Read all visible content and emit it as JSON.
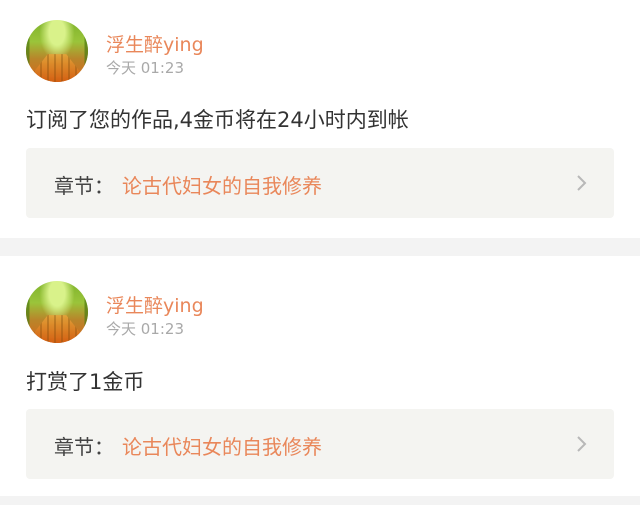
{
  "notifications": [
    {
      "username": "浮生醉ying",
      "time": "今天 01:23",
      "message": "订阅了您的作品,4金币将在24小时内到帐",
      "chapter_prefix": "章节：",
      "chapter_title": "论古代妇女的自我修养",
      "chevron_icon": "chevron-right-icon"
    },
    {
      "username": "浮生醉ying",
      "time": "今天 01:23",
      "message": "打赏了1金币",
      "chapter_prefix": "章节：",
      "chapter_title": "论古代妇女的自我修养",
      "chevron_icon": "chevron-right-icon"
    }
  ],
  "colors": {
    "accent": "#e9875a",
    "text": "#333333",
    "muted": "#a9a9a9",
    "chapter_bg": "#f4f4f1",
    "page_bg": "#f3f3f3"
  }
}
